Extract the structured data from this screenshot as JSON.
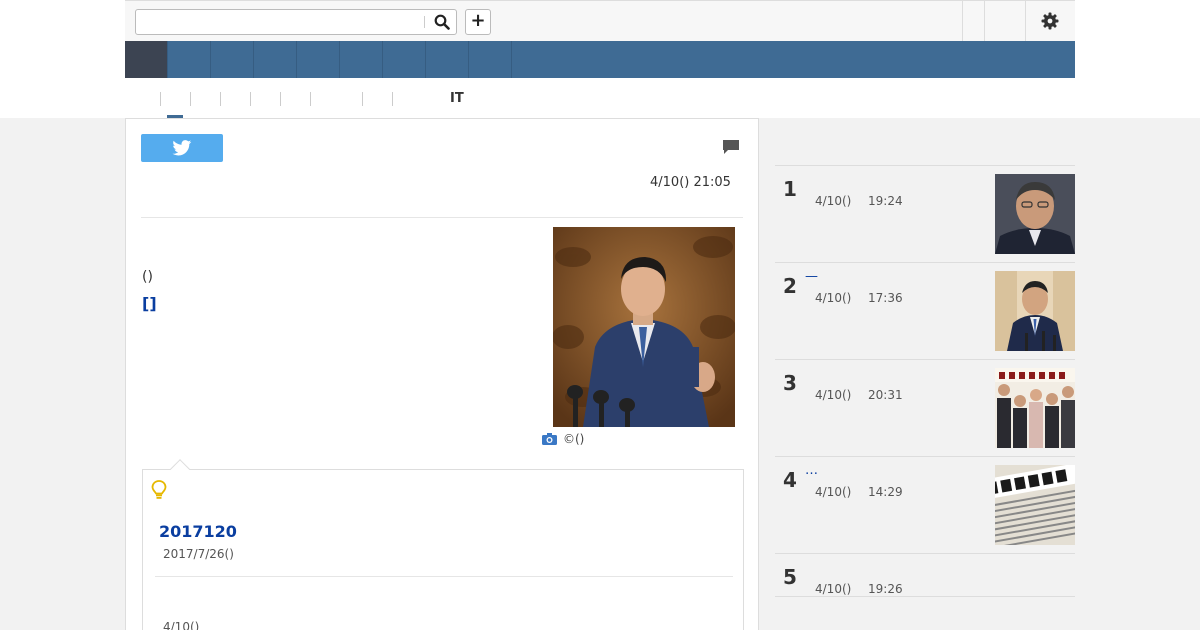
{
  "search": {
    "placeholder": "",
    "value": ""
  },
  "toolbar": {
    "add_label": "+"
  },
  "subnav": {
    "items": [
      "",
      "",
      "",
      "",
      "",
      "IT",
      "",
      ""
    ]
  },
  "article": {
    "date": "4/10() 21:05",
    "paren_text": "()",
    "bracket_link": "[]",
    "photo_caption": "©()"
  },
  "related": {
    "title": "2017120",
    "date": "2017/7/26()",
    "date2": "4/10()"
  },
  "ranking": [
    {
      "rank": "1",
      "title": "",
      "date": "4/10()",
      "time": "19:24",
      "thumb": "person-portrait"
    },
    {
      "rank": "2",
      "title": "—",
      "date": "4/10()",
      "time": "17:36",
      "thumb": "press-conference"
    },
    {
      "rank": "3",
      "title": "",
      "date": "4/10()",
      "time": "20:31",
      "thumb": "group-photo"
    },
    {
      "rank": "4",
      "title": "…",
      "date": "4/10()",
      "time": "14:29",
      "thumb": "newspaper"
    },
    {
      "rank": "5",
      "title": "",
      "date": "4/10()",
      "time": "19:26",
      "thumb": ""
    }
  ],
  "colors": {
    "nav_blue": "#3f6b94",
    "nav_active": "#3c4452",
    "link_blue": "#0a3ea0",
    "twitter_blue": "#55acee"
  },
  "icons": [
    "search-icon",
    "plus-icon",
    "gear-icon",
    "twitter-icon",
    "comment-icon",
    "camera-icon",
    "lightbulb-icon"
  ]
}
